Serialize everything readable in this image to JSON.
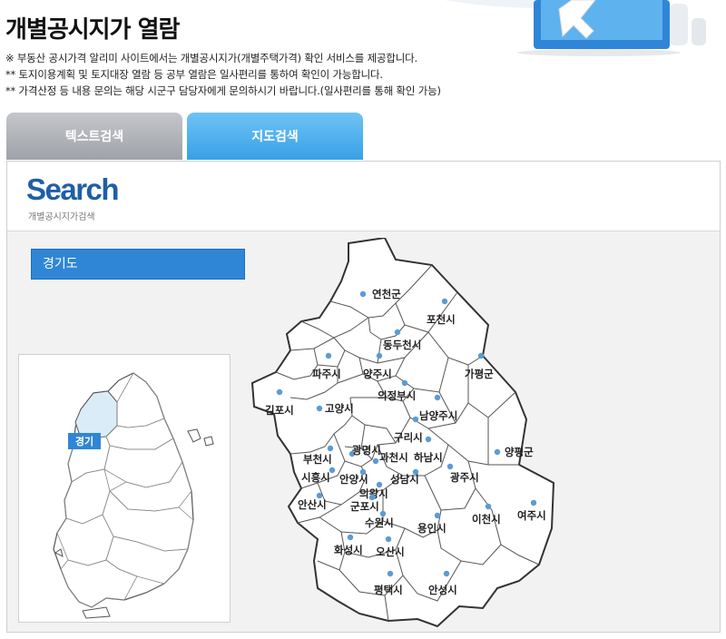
{
  "header": {
    "title": "개별공시지가 열람",
    "notices": [
      "※ 부동산 공시가격 알리미 사이트에서는 개별공시지가(개별주택가격) 확인 서비스를 제공합니다.",
      "** 토지이용계획 및 토지대장 열람 등 공부 열람은 일사편리를 통하여 확인이 가능합니다.",
      "** 가격산정 등 내용 문의는 해당 시군구 담당자에게 문의하시기 바랍니다.(일사편리를 통해 확인 가능)"
    ]
  },
  "tabs": [
    {
      "label": "텍스트검색",
      "active": false
    },
    {
      "label": "지도검색",
      "active": true
    }
  ],
  "search_panel": {
    "title": "Search",
    "subtitle": "개별공시지가검색",
    "selected_region": "경기도"
  },
  "minimap": {
    "highlight_label": "경기",
    "highlight_color": "#d9ecf8",
    "label_bg": "#2f86d6"
  },
  "map": {
    "dot_color": "#5b9bd5",
    "cities": [
      "연천군",
      "포천시",
      "동두천시",
      "파주시",
      "양주시",
      "가평군",
      "의정부시",
      "김포시",
      "고양시",
      "남양주시",
      "구리시",
      "하남시",
      "양평군",
      "부천시",
      "광명시",
      "과천시",
      "시흥시",
      "안양시",
      "성남시",
      "광주시",
      "의왕시",
      "안산시",
      "군포시",
      "수원시",
      "용인시",
      "이천시",
      "여주시",
      "화성시",
      "오산시",
      "평택시",
      "안성시"
    ]
  }
}
